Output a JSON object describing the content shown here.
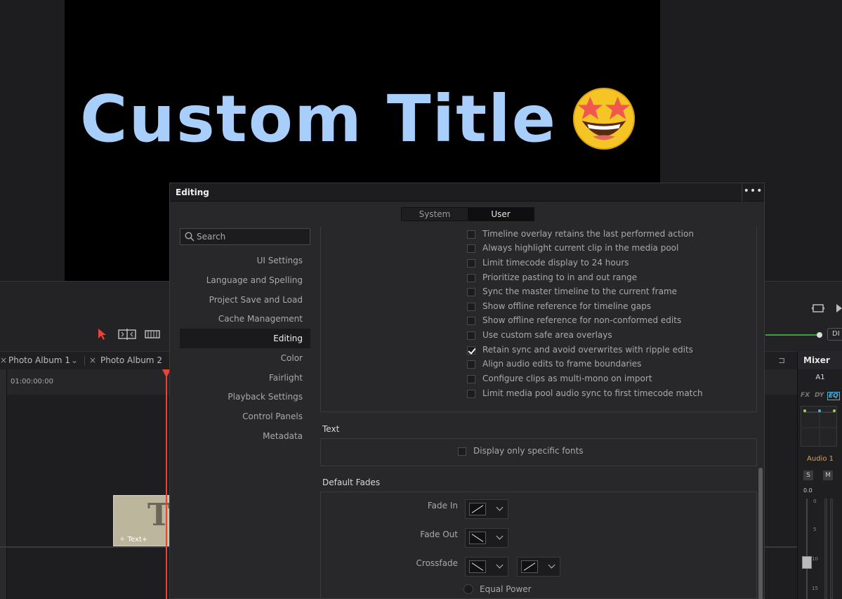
{
  "viewer": {
    "title_text": "Custom Title"
  },
  "timeline": {
    "tabs": [
      {
        "label": "Photo Album 1"
      },
      {
        "label": "Photo Album 2"
      }
    ],
    "timecode": "01:00:00:00",
    "clip_label": "Text+",
    "clip_letter": "T",
    "accent_color": "#e8433a"
  },
  "mixer": {
    "title": "Mixer",
    "channel": "A1",
    "fx": "FX",
    "dy": "DY",
    "eq": "EQ",
    "track": "Audio 1",
    "solo": "S",
    "mute": "M",
    "level": "0.0",
    "scale": [
      "0",
      "5",
      "10",
      "15"
    ]
  },
  "dialog": {
    "title": "Editing",
    "more_icon": "more-icon",
    "segments": [
      {
        "label": "System",
        "active": false
      },
      {
        "label": "User",
        "active": true
      }
    ],
    "search": {
      "placeholder": "Search"
    },
    "nav": [
      {
        "label": "UI Settings",
        "active": false
      },
      {
        "label": "Language and Spelling",
        "active": false
      },
      {
        "label": "Project Save and Load",
        "active": false
      },
      {
        "label": "Cache Management",
        "active": false
      },
      {
        "label": "Editing",
        "active": true
      },
      {
        "label": "Color",
        "active": false
      },
      {
        "label": "Fairlight",
        "active": false
      },
      {
        "label": "Playback Settings",
        "active": false
      },
      {
        "label": "Control Panels",
        "active": false
      },
      {
        "label": "Metadata",
        "active": false
      }
    ],
    "options": [
      {
        "label": "Timeline overlay retains the last performed action",
        "checked": false
      },
      {
        "label": "Always highlight current clip in the media pool",
        "checked": false
      },
      {
        "label": "Limit timecode display to 24 hours",
        "checked": false
      },
      {
        "label": "Prioritize pasting to in and out range",
        "checked": false
      },
      {
        "label": "Sync the master timeline to the current frame",
        "checked": false
      },
      {
        "label": "Show offline reference for timeline gaps",
        "checked": false
      },
      {
        "label": "Show offline reference for non-conformed edits",
        "checked": false
      },
      {
        "label": "Use custom safe area overlays",
        "checked": false
      },
      {
        "label": "Retain sync and avoid overwrites with ripple edits",
        "checked": true
      },
      {
        "label": "Align audio edits to frame boundaries",
        "checked": false
      },
      {
        "label": "Configure clips as multi-mono on import",
        "checked": false
      },
      {
        "label": "Limit media pool audio sync to first timecode match",
        "checked": false
      }
    ],
    "text_section": {
      "heading": "Text",
      "option": "Display only specific fonts"
    },
    "fades_section": {
      "heading": "Default Fades",
      "fade_in": "Fade In",
      "fade_out": "Fade Out",
      "crossfade": "Crossfade",
      "equal_power": "Equal Power"
    }
  }
}
